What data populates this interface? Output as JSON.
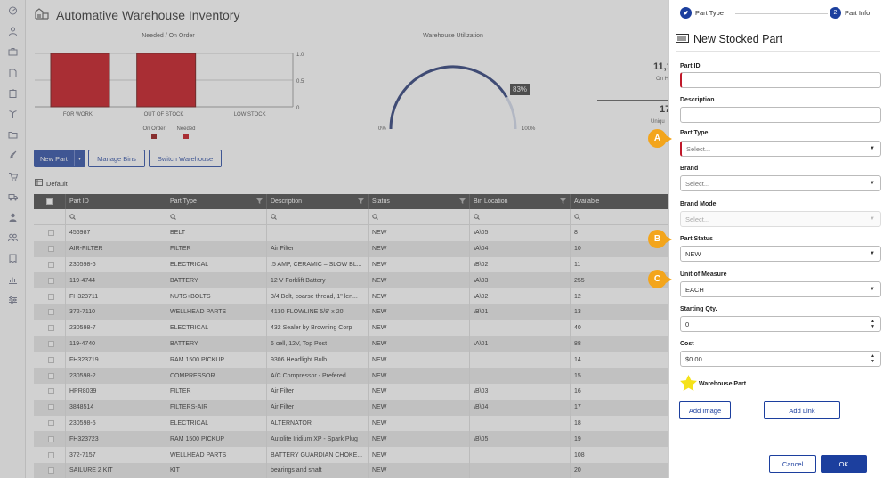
{
  "app": {
    "title": "Automative Warehouse Inventory"
  },
  "rail": {
    "icons": [
      "dashboard-icon",
      "person-icon",
      "briefcase-icon",
      "document-icon",
      "clipboard-icon",
      "plant-icon",
      "folder-icon",
      "rocket-icon",
      "cart-icon",
      "truck-icon",
      "user-icon",
      "group-icon",
      "receipt-icon",
      "chart-icon",
      "settings-icon"
    ]
  },
  "needed_chart": {
    "title": "Needed / On Order",
    "categories": [
      "FOR WORK",
      "OUT OF STOCK",
      "LOW STOCK"
    ],
    "yticks": [
      "1.0",
      "0.5",
      "0"
    ],
    "legend": [
      "On Order",
      "Needed"
    ],
    "colors": {
      "on_order": "#8b0000",
      "needed": "#c0000a"
    }
  },
  "chart_data": {
    "type": "bar",
    "categories": [
      "FOR WORK",
      "OUT OF STOCK",
      "LOW STOCK"
    ],
    "series": [
      {
        "name": "On Order",
        "values": [
          0,
          0,
          0
        ]
      },
      {
        "name": "Needed",
        "values": [
          1,
          1,
          0
        ]
      }
    ],
    "title": "Needed / On Order",
    "ylim": [
      0,
      1
    ]
  },
  "utilization": {
    "title": "Warehouse Utilization",
    "value_label": "83%",
    "min_label": "0%",
    "max_label": "100%",
    "fraction": 0.83
  },
  "stats": {
    "value1": "11,1",
    "label1": "On H",
    "value2": "17",
    "label2": "Uniqu"
  },
  "toolbar": {
    "new_part": "New Part",
    "manage_bins": "Manage Bins",
    "switch_warehouse": "Switch Warehouse",
    "view": "Default"
  },
  "grid": {
    "columns": [
      "Part ID",
      "Part Type",
      "Description",
      "Status",
      "Bin Location",
      "Available"
    ],
    "rows": [
      [
        "456987",
        "BELT",
        "",
        "NEW",
        "\\A\\05",
        "8"
      ],
      [
        "AIR-FILTER",
        "FILTER",
        "Air Filter",
        "NEW",
        "\\A\\04",
        "10"
      ],
      [
        "230598-6",
        "ELECTRICAL",
        ".5 AMP, CERAMIC – SLOW BL...",
        "NEW",
        "\\B\\02",
        "11"
      ],
      [
        "119-4744",
        "BATTERY",
        "12 V Forklift Battery",
        "NEW",
        "\\A\\03",
        "255"
      ],
      [
        "FH323711",
        "NUTS+BOLTS",
        "3/4 Bolt, coarse thread, 1\" len...",
        "NEW",
        "\\A\\02",
        "12"
      ],
      [
        "372-7110",
        "WELLHEAD PARTS",
        "4130 FLOWLINE 5/8' x 20'",
        "NEW",
        "\\B\\01",
        "13"
      ],
      [
        "230598-7",
        "ELECTRICAL",
        "432 Sealer by Browning Corp",
        "NEW",
        "",
        "40"
      ],
      [
        "119-4740",
        "BATTERY",
        "6 cell, 12V, Top Post",
        "NEW",
        "\\A\\01",
        "88"
      ],
      [
        "FH323719",
        "RAM 1500 PICKUP",
        "9306 Headlight Bulb",
        "NEW",
        "",
        "14"
      ],
      [
        "230598-2",
        "COMPRESSOR",
        "A/C Compressor - Prefered",
        "NEW",
        "",
        "15"
      ],
      [
        "HPR8039",
        "FILTER",
        "Air Filter",
        "NEW",
        "\\B\\03",
        "16"
      ],
      [
        "3848514",
        "FILTERS-AIR",
        "Air Filter",
        "NEW",
        "\\B\\04",
        "17"
      ],
      [
        "230598-5",
        "ELECTRICAL",
        "ALTERNATOR",
        "NEW",
        "",
        "18"
      ],
      [
        "FH323723",
        "RAM 1500 PICKUP",
        "Autolite Iridium XP - Spark Plug",
        "NEW",
        "\\B\\05",
        "19"
      ],
      [
        "372-7157",
        "WELLHEAD PARTS",
        "BATTERY GUARDIAN CHOKE...",
        "NEW",
        "",
        "108"
      ],
      [
        "SAILURE 2 KIT",
        "KIT",
        "bearings and shaft",
        "NEW",
        "",
        "20"
      ]
    ]
  },
  "panel": {
    "steps": [
      "Part Type",
      "Part Info"
    ],
    "step2_num": "2",
    "title": "New Stocked Part",
    "fields": {
      "part_id": {
        "label": "Part ID",
        "value": ""
      },
      "description": {
        "label": "Description",
        "value": ""
      },
      "part_type": {
        "label": "Part Type",
        "value": "Select..."
      },
      "brand": {
        "label": "Brand",
        "value": "Select..."
      },
      "brand_model": {
        "label": "Brand Model",
        "value": "Select..."
      },
      "part_status": {
        "label": "Part Status",
        "value": "NEW"
      },
      "uom": {
        "label": "Unit of Measure",
        "value": "EACH"
      },
      "starting_qty": {
        "label": "Starting Qty.",
        "value": "0"
      },
      "cost": {
        "label": "Cost",
        "value": "$0.00"
      }
    },
    "warehouse_part": "Warehouse Part",
    "add_image": "Add Image",
    "add_link": "Add Link",
    "cancel": "Cancel",
    "ok": "OK",
    "callouts": [
      "A",
      "B",
      "C"
    ],
    "accent": "#1c3f9e"
  }
}
